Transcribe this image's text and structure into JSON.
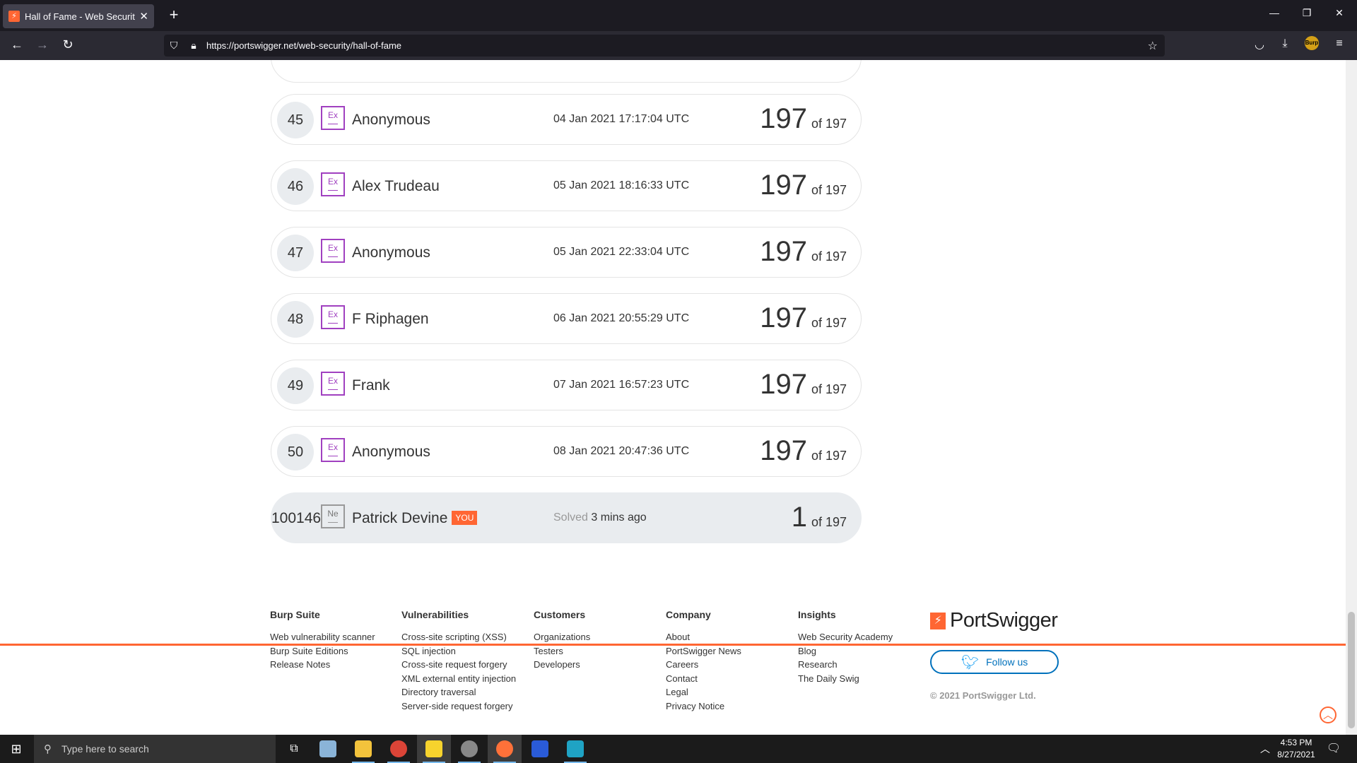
{
  "browser": {
    "tab_title": "Hall of Fame - Web Security Ac",
    "url": "https://portswigger.net/web-security/hall-of-fame",
    "extension_label": "Burp"
  },
  "leaderboard": [
    {
      "rank": "45",
      "badge": "Ex",
      "name": "Anonymous",
      "date": "04 Jan 2021 17:17:04 UTC",
      "score": "197",
      "total": "of 197"
    },
    {
      "rank": "46",
      "badge": "Ex",
      "name": "Alex Trudeau",
      "date": "05 Jan 2021 18:16:33 UTC",
      "score": "197",
      "total": "of 197"
    },
    {
      "rank": "47",
      "badge": "Ex",
      "name": "Anonymous",
      "date": "05 Jan 2021 22:33:04 UTC",
      "score": "197",
      "total": "of 197"
    },
    {
      "rank": "48",
      "badge": "Ex",
      "name": "F Riphagen",
      "date": "06 Jan 2021 20:55:29 UTC",
      "score": "197",
      "total": "of 197"
    },
    {
      "rank": "49",
      "badge": "Ex",
      "name": "Frank",
      "date": "07 Jan 2021 16:57:23 UTC",
      "score": "197",
      "total": "of 197"
    },
    {
      "rank": "50",
      "badge": "Ex",
      "name": "Anonymous",
      "date": "08 Jan 2021 20:47:36 UTC",
      "score": "197",
      "total": "of 197"
    }
  ],
  "current_user": {
    "rank": "100146",
    "badge": "Ne",
    "name": "Patrick Devine",
    "tag": "YOU",
    "solved_label": "Solved",
    "solved_ago": "3 mins ago",
    "score": "1",
    "total": "of 197"
  },
  "footer": {
    "columns": [
      {
        "heading": "Burp Suite",
        "links": [
          "Web vulnerability scanner",
          "Burp Suite Editions",
          "Release Notes"
        ]
      },
      {
        "heading": "Vulnerabilities",
        "links": [
          "Cross-site scripting (XSS)",
          "SQL injection",
          "Cross-site request forgery",
          "XML external entity injection",
          "Directory traversal",
          "Server-side request forgery"
        ]
      },
      {
        "heading": "Customers",
        "links": [
          "Organizations",
          "Testers",
          "Developers"
        ]
      },
      {
        "heading": "Company",
        "links": [
          "About",
          "PortSwigger News",
          "Careers",
          "Contact",
          "Legal",
          "Privacy Notice"
        ]
      },
      {
        "heading": "Insights",
        "links": [
          "Web Security Academy",
          "Blog",
          "Research",
          "The Daily Swig"
        ]
      }
    ],
    "logo_text": "PortSwigger",
    "follow_label": "Follow us",
    "copyright": "© 2021 PortSwigger Ltd."
  },
  "taskbar": {
    "search_placeholder": "Type here to search",
    "time": "4:53 PM",
    "date": "8/27/2021"
  },
  "colors": {
    "accent": "#ff6633",
    "expert_badge": "#a040c0",
    "twitter": "#1da1f2"
  }
}
